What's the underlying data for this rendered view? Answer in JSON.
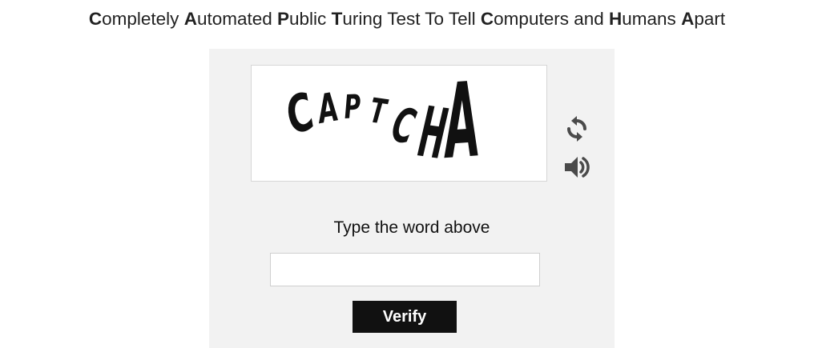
{
  "header": {
    "parts": [
      {
        "bold": "C",
        "rest": "ompletely "
      },
      {
        "bold": "A",
        "rest": "utomated "
      },
      {
        "bold": "P",
        "rest": "ublic "
      },
      {
        "bold": "T",
        "rest": "uring Test To Tell "
      },
      {
        "bold": "C",
        "rest": "omputers and "
      },
      {
        "bold": "H",
        "rest": "umans "
      },
      {
        "bold": "A",
        "rest": "part"
      }
    ]
  },
  "captcha": {
    "letters": [
      "C",
      "A",
      "P",
      "T",
      "C",
      "H",
      "A"
    ],
    "refresh_icon": "refresh-icon",
    "audio_icon": "speaker-audio-icon"
  },
  "form": {
    "prompt": "Type the word above",
    "answer_value": "",
    "answer_placeholder": "",
    "verify_label": "Verify"
  },
  "colors": {
    "panel_bg": "#f2f2f2",
    "button_bg": "#111111",
    "icon": "#4a4a4a"
  }
}
